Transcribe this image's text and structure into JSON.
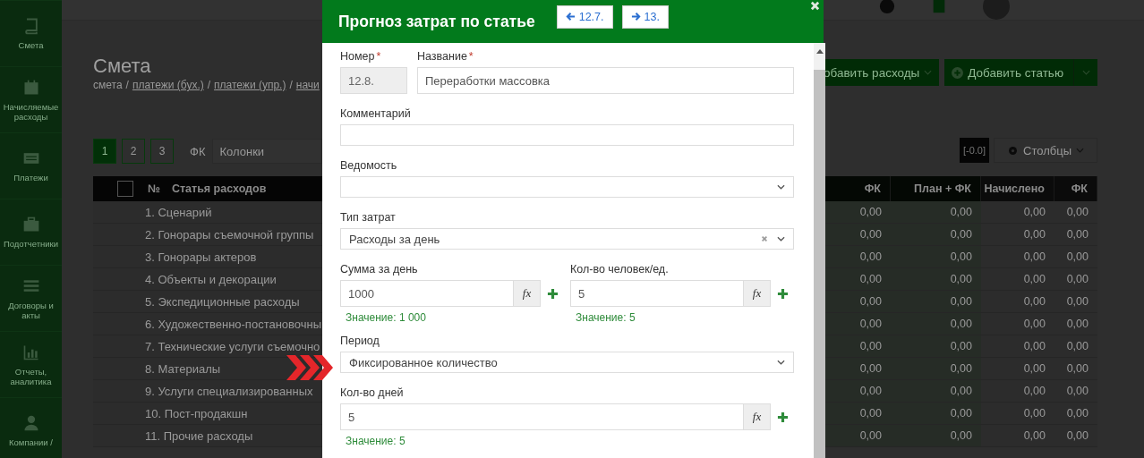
{
  "sidebar": {
    "items": [
      {
        "kind": "book",
        "label": "Смета"
      },
      {
        "kind": "calendar",
        "label": "Начисляемые расходы"
      },
      {
        "kind": "card",
        "label": "Платежи"
      },
      {
        "kind": "briefcase",
        "label": "Подотчетники"
      },
      {
        "kind": "list",
        "label": "Договоры и акты"
      },
      {
        "kind": "chart",
        "label": "Отчеты, аналитика"
      },
      {
        "kind": "user",
        "label": "Компании /"
      }
    ]
  },
  "page": {
    "title": "Смета",
    "breadcrumb": [
      {
        "text": "смета",
        "link": false
      },
      {
        "text": "платежи (бух.)",
        "link": true
      },
      {
        "text": "платежи (упр.)",
        "link": true
      },
      {
        "text": "начи",
        "link": true
      }
    ],
    "separator": "/",
    "actions": [
      {
        "label": "обавить расходы",
        "icon": false,
        "split": false
      },
      {
        "label": "Добавить статью",
        "icon": true,
        "split": true
      }
    ],
    "pages": [
      {
        "label": "1",
        "selected": true
      },
      {
        "label": "2",
        "selected": false
      },
      {
        "label": "3",
        "selected": false
      }
    ],
    "filter_label": "ФК",
    "columns_select": "Колонки",
    "rounding_button": "[-0.0]",
    "columns_button": "Столбцы"
  },
  "table": {
    "select_all_checked": false,
    "left_columns": [
      "№",
      "Статья расходов"
    ],
    "right_columns": [
      "ФК",
      "План + ФК",
      "Начислено",
      "ФК"
    ],
    "rows": [
      {
        "name": "1. Сценарий",
        "values": [
          "0,00",
          "0,00",
          "0,00",
          "0,00"
        ]
      },
      {
        "name": "2. Гонорары съемочной группы",
        "values": [
          "0,00",
          "0,00",
          "0,00",
          "0,00"
        ]
      },
      {
        "name": "3. Гонорары актеров",
        "values": [
          "0,00",
          "0,00",
          "0,00",
          "0,00"
        ]
      },
      {
        "name": "4. Объекты и декорации",
        "values": [
          "0,00",
          "0,00",
          "0,00",
          "0,00"
        ]
      },
      {
        "name": "5. Экспедиционные расходы",
        "values": [
          "0,00",
          "0,00",
          "0,00",
          "0,00"
        ]
      },
      {
        "name": "6. Художественно-постановочны",
        "values": [
          "0,00",
          "0,00",
          "0,00",
          "0,00"
        ]
      },
      {
        "name": "7. Технические услуги съемочно",
        "values": [
          "0,00",
          "0,00",
          "0,00",
          "0,00"
        ]
      },
      {
        "name": "8. Материалы",
        "values": [
          "0,00",
          "0,00",
          "0,00",
          "0,00"
        ]
      },
      {
        "name": "9. Услуги специализированных",
        "values": [
          "0,00",
          "0,00",
          "0,00",
          "0,00"
        ]
      },
      {
        "name": "10. Пост-продакшн",
        "values": [
          "0,00",
          "0,00",
          "0,00",
          "0,00"
        ]
      },
      {
        "name": "11. Прочие расходы",
        "values": [
          "0,00",
          "0,00",
          "0,00",
          "0,00"
        ]
      }
    ]
  },
  "modal": {
    "title": "Прогноз затрат по статье",
    "prev": "12.7.",
    "next": "13.",
    "required_mark": "*",
    "number": {
      "label": "Номер",
      "required": true,
      "value": "12.8.",
      "disabled": true
    },
    "name": {
      "label": "Название",
      "required": true,
      "value": "Переработки массовка"
    },
    "comment": {
      "label": "Комментарий"
    },
    "statement": {
      "label": "Ведомость"
    },
    "cost_type": {
      "label": "Тип затрат",
      "value": "Расходы за день",
      "clearable": true
    },
    "sum_per_day": {
      "label": "Сумма за день",
      "value": "1000",
      "formula_button": "fx",
      "hint": "Значение: 1 000"
    },
    "people": {
      "label": "Кол-во человек/ед.",
      "value": "5",
      "formula_button": "fx",
      "hint": "Значение: 5"
    },
    "period": {
      "label": "Период",
      "value": "Фиксированное количество"
    },
    "days": {
      "label": "Кол-во дней",
      "value": "5",
      "formula_button": "fx",
      "hint": "Значение: 5"
    }
  }
}
